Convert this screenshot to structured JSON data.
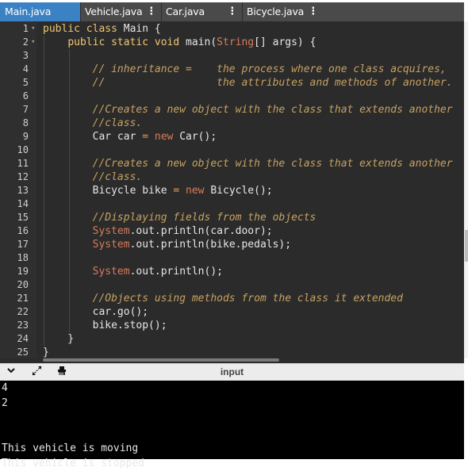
{
  "tabs": [
    {
      "label": "Main.java",
      "active": true,
      "menu": ""
    },
    {
      "label": "Vehicle.java",
      "active": false,
      "menu": "⋮"
    },
    {
      "label": "Car.java",
      "active": false,
      "menu": "⋮"
    },
    {
      "label": "Bicycle.java",
      "active": false,
      "menu": "⋮"
    }
  ],
  "editor": {
    "line_numbers": [
      "1",
      "2",
      "3",
      "4",
      "5",
      "6",
      "7",
      "8",
      "9",
      "10",
      "11",
      "12",
      "13",
      "14",
      "15",
      "16",
      "17",
      "18",
      "19",
      "20",
      "21",
      "22",
      "23",
      "24",
      "25"
    ],
    "lines": [
      [
        [
          "kw",
          "public class "
        ],
        [
          "pl",
          "Main {"
        ]
      ],
      [
        [
          "pl",
          "    "
        ],
        [
          "kw",
          "public static void "
        ],
        [
          "pl",
          "main("
        ],
        [
          "ty",
          "String"
        ],
        [
          "pl",
          "[] args) {"
        ]
      ],
      [],
      [
        [
          "pl",
          "        "
        ],
        [
          "cm",
          "// inheritance =    the process where one class acquires,"
        ]
      ],
      [
        [
          "pl",
          "        "
        ],
        [
          "cm",
          "//                  the attributes and methods of another."
        ]
      ],
      [],
      [
        [
          "pl",
          "        "
        ],
        [
          "cm",
          "//Creates a new object with the class that extends another"
        ]
      ],
      [
        [
          "pl",
          "        "
        ],
        [
          "cm",
          "//class."
        ]
      ],
      [
        [
          "pl",
          "        Car car "
        ],
        [
          "op",
          "= "
        ],
        [
          "ty",
          "new "
        ],
        [
          "pl",
          "Car();"
        ]
      ],
      [],
      [
        [
          "pl",
          "        "
        ],
        [
          "cm",
          "//Creates a new object with the class that extends another"
        ]
      ],
      [
        [
          "pl",
          "        "
        ],
        [
          "cm",
          "//class."
        ]
      ],
      [
        [
          "pl",
          "        Bicycle bike "
        ],
        [
          "op",
          "= "
        ],
        [
          "ty",
          "new "
        ],
        [
          "pl",
          "Bicycle();"
        ]
      ],
      [],
      [
        [
          "pl",
          "        "
        ],
        [
          "cm",
          "//Displaying fields from the objects"
        ]
      ],
      [
        [
          "pl",
          "        "
        ],
        [
          "ty",
          "System"
        ],
        [
          "pl",
          ".out.println(car.door);"
        ]
      ],
      [
        [
          "pl",
          "        "
        ],
        [
          "ty",
          "System"
        ],
        [
          "pl",
          ".out.println(bike.pedals);"
        ]
      ],
      [],
      [
        [
          "pl",
          "        "
        ],
        [
          "ty",
          "System"
        ],
        [
          "pl",
          ".out.println();"
        ]
      ],
      [],
      [
        [
          "pl",
          "        "
        ],
        [
          "cm",
          "//Objects using methods from the class it extended"
        ]
      ],
      [
        [
          "pl",
          "        car.go();"
        ]
      ],
      [
        [
          "pl",
          "        bike.stop();"
        ]
      ],
      [
        [
          "pl",
          "    }"
        ]
      ],
      [
        [
          "pl",
          "}"
        ]
      ]
    ]
  },
  "console": {
    "title": "input",
    "icons": [
      "chevron-down-icon",
      "expand-icon",
      "clear-console-icon"
    ],
    "output": [
      "4",
      "2",
      "",
      "",
      "This vehicle is moving",
      "This vehicle is stopped"
    ]
  }
}
